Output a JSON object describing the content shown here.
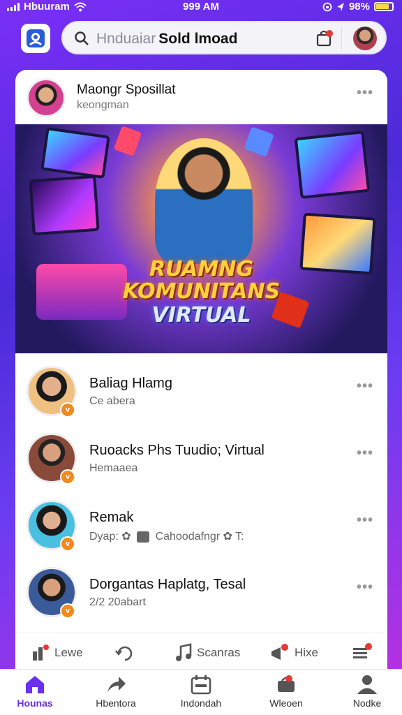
{
  "status": {
    "carrier": "Hbuuram",
    "time": "999 AM",
    "battery": "98%"
  },
  "search": {
    "placeholder": "Hnduaiar",
    "value": "Sold lmoad"
  },
  "post": {
    "author": "Maongr Sposillat",
    "subtitle": "keongman",
    "banner_line1": "RUAMNG",
    "banner_line2": "KOMUNITANS",
    "banner_line3": "VIRTUAL"
  },
  "rows": [
    {
      "name": "Baliag Hlamg",
      "meta": "Ce abera",
      "badge": "v"
    },
    {
      "name": "Ruoacks Phs Tuudio; Virtual",
      "meta": "Hemaaea",
      "badge": "v"
    },
    {
      "name": "Remak",
      "meta_a": "Dyap:",
      "meta_b": "Cahoodafngr",
      "meta_c": "T:",
      "badge": "v"
    },
    {
      "name": "Dorgantas Haplatg, Tesal",
      "meta": "2/2 20abart",
      "badge": "v"
    }
  ],
  "quickbar": [
    {
      "label": "Lewe",
      "icon": "chart-icon"
    },
    {
      "label": "",
      "icon": "refresh-icon"
    },
    {
      "label": "Scanras",
      "icon": "music-note-icon"
    },
    {
      "label": "Hixe",
      "icon": "megaphone-icon"
    },
    {
      "label": "",
      "icon": "list-icon"
    }
  ],
  "nav": [
    {
      "label": "Hounas",
      "icon": "home-icon",
      "active": true
    },
    {
      "label": "Hbentora",
      "icon": "share-icon"
    },
    {
      "label": "Indondah",
      "icon": "calendar-icon"
    },
    {
      "label": "Wleoen",
      "icon": "notification-icon"
    },
    {
      "label": "Nodke",
      "icon": "profile-icon"
    }
  ],
  "colors": {
    "accent": "#6a2ff0",
    "badge": "#f08a1c",
    "notification": "#e53935"
  }
}
